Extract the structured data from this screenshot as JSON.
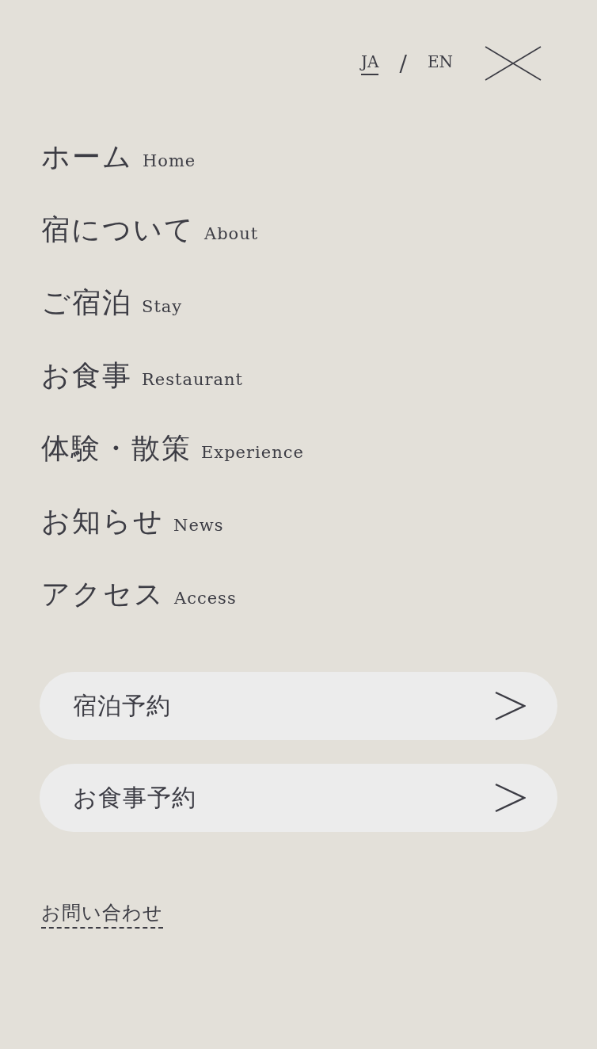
{
  "languages": [
    {
      "label": "JA",
      "selected": true
    },
    {
      "label": "EN",
      "selected": false
    }
  ],
  "separator": "/",
  "menu": [
    {
      "ja": "ホーム",
      "en": "Home"
    },
    {
      "ja": "宿について",
      "en": "About"
    },
    {
      "ja": "ご宿泊",
      "en": "Stay"
    },
    {
      "ja": "お食事",
      "en": "Restaurant"
    },
    {
      "ja": "体験・散策",
      "en": "Experience"
    },
    {
      "ja": "お知らせ",
      "en": "News"
    },
    {
      "ja": "アクセス",
      "en": "Access"
    }
  ],
  "reserve_buttons": [
    {
      "label": "宿泊予約"
    },
    {
      "label": "お食事予約"
    }
  ],
  "contact_link": "お問い合わせ"
}
